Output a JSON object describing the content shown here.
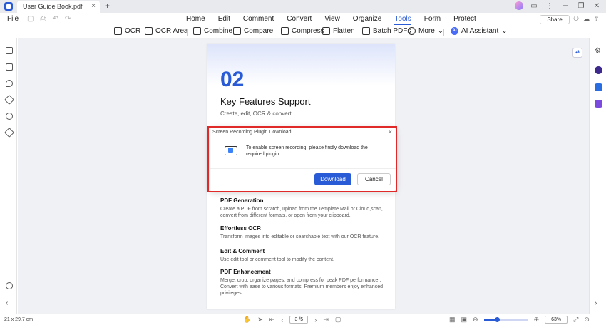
{
  "titlebar": {
    "doc_tab_label": "User Guide Book.pdf",
    "close_glyph": "×",
    "new_tab_glyph": "+"
  },
  "menubar": {
    "file_label": "File",
    "menus": [
      "Home",
      "Edit",
      "Comment",
      "Convert",
      "View",
      "Organize",
      "Tools",
      "Form",
      "Protect"
    ],
    "active_menu": "Tools",
    "share_label": "Share"
  },
  "toolbar": {
    "ocr_label": "OCR",
    "ocr_area_label": "OCR Area",
    "combine_label": "Combine",
    "compare_label": "Compare",
    "compress_label": "Compress",
    "flatten_label": "Flatten",
    "batch_pdfs_label": "Batch PDFs",
    "more_label": "More",
    "ai_assistant_label": "AI Assistant",
    "ai_glyph": "AI",
    "caret_glyph": "⌄"
  },
  "page": {
    "number": "02",
    "title": "Key Features Support",
    "subtitle": "Create, edit, OCR & convert.",
    "features": [
      {
        "heading": "PDF Generation",
        "text": "Create a PDF from scratch, upload from the Template Mall or Cloud,scan, convert from different formats, or open from your clipboard."
      },
      {
        "heading": "Effortless OCR",
        "text": "Transform images into editable or searchable text with our OCR feature."
      },
      {
        "heading": "Edit & Comment",
        "text": "Use edit tool or comment tool to modify the content."
      },
      {
        "heading": "PDF Enhancement",
        "text": "Merge, crop, organize pages, and compress for peak PDF performance . Convert with ease to various formats. Premium members enjoy enhanced privileges."
      }
    ]
  },
  "dialog": {
    "title": "Screen Recording Plugin Download",
    "message": "To enable screen recording, please firstly download the required plugin.",
    "download_label": "Download",
    "cancel_label": "Cancel",
    "close_glyph": "×"
  },
  "statusbar": {
    "page_size": "21 x 29.7 cm",
    "page_indicator": "3 /5",
    "zoom": "63%",
    "zoom_level": 0.3
  },
  "colors": {
    "accent": "#2a5bd7",
    "highlight_outline": "#e02a2a"
  }
}
